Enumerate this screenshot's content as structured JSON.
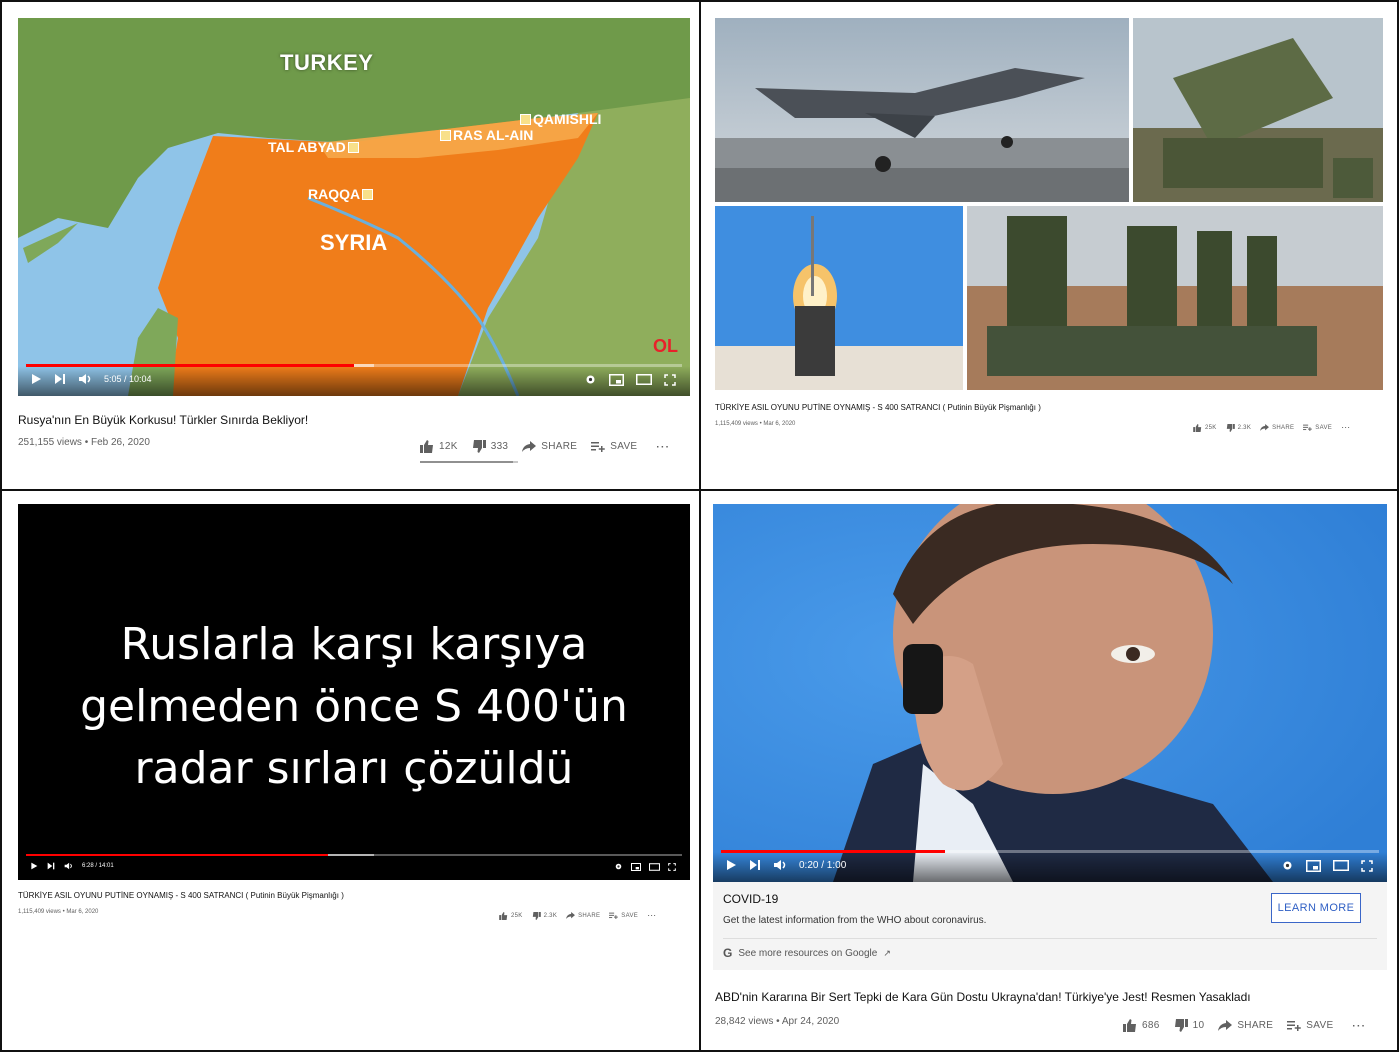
{
  "panels": {
    "top_left": {
      "map_labels": {
        "turkey": "TURKEY",
        "tal_abyad": "TAL ABYAD",
        "ras_al_ain": "RAS AL-AIN",
        "qamishli": "QAMISHLI",
        "raqqa": "RAQQA",
        "syria": "SYRIA",
        "watermark": "OL"
      },
      "player": {
        "time": "5:05 / 10:04",
        "progress": 0.5,
        "buffered": 0.53
      },
      "title": "Rusya'nın En Büyük Korkusu! Türkler Sınırda Bekliyor!",
      "meta": "251,155 views • Feb 26, 2020",
      "actions": {
        "likes": "12K",
        "dislikes": "333",
        "share": "SHARE",
        "save": "SAVE"
      }
    },
    "top_right": {
      "title": "TÜRKİYE ASIL OYUNU PUTİNE OYNAMIŞ - S 400 SATRANCI ( Putinin Büyük Pişmanlığı )",
      "meta": "1,115,409 views • Mar 6, 2020",
      "actions": {
        "likes": "25K",
        "dislikes": "2.3K",
        "share": "SHARE",
        "save": "SAVE"
      }
    },
    "bottom_left": {
      "overlay_text": [
        "Ruslarla karşı karşıya",
        "gelmeden önce S 400'ün",
        "radar sırları çözüldü"
      ],
      "player": {
        "time": "6:28 / 14:01",
        "progress": 0.46,
        "buffered": 0.53
      },
      "title": "TÜRKİYE ASIL OYUNU PUTİNE OYNAMIŞ - S 400 SATRANCI ( Putinin Büyük Pişmanlığı )",
      "meta": "1,115,409 views • Mar 6, 2020",
      "actions": {
        "likes": "25K",
        "dislikes": "2.3K",
        "share": "SHARE",
        "save": "SAVE"
      }
    },
    "bottom_right": {
      "player": {
        "time": "0:20 / 1:00",
        "progress": 0.34,
        "buffered": 0.34
      },
      "covid": {
        "heading": "COVID-19",
        "text": "Get the latest information from the WHO about coronavirus.",
        "button": "LEARN MORE",
        "google_link": "See more resources on Google"
      },
      "title": "ABD'nin Kararına Bir Sert Tepki de Kara Gün Dostu Ukrayna'dan! Türkiye'ye Jest! Resmen Yasakladı",
      "meta": "28,842 views • Apr 24, 2020",
      "actions": {
        "likes": "686",
        "dislikes": "10",
        "share": "SHARE",
        "save": "SAVE"
      }
    }
  },
  "colors": {
    "progress": "#ff0000",
    "map_sea": "#8fc4e8",
    "map_land": "#7fa85a",
    "map_syria": "#f07d1a",
    "video_bg_dark": "#000000",
    "sky": "#3f8ee0",
    "learn_more": "#2f5fc4"
  }
}
